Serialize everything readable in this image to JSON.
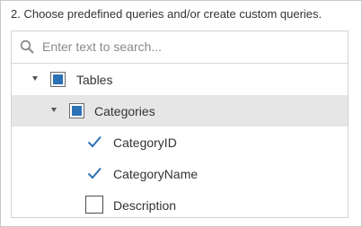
{
  "instruction": "2. Choose predefined queries and/or create custom queries.",
  "search": {
    "placeholder": "Enter text to search...",
    "value": ""
  },
  "tree": {
    "root": {
      "label": "Tables",
      "expanded": true,
      "state": "indeterminate"
    },
    "table": {
      "label": "Categories",
      "expanded": true,
      "state": "indeterminate",
      "selected": true
    },
    "columns": [
      {
        "label": "CategoryID",
        "checked": true
      },
      {
        "label": "CategoryName",
        "checked": true
      },
      {
        "label": "Description",
        "checked": false
      }
    ]
  },
  "colors": {
    "accent": "#2c70b6",
    "selected_row": "#e6e6e6"
  }
}
